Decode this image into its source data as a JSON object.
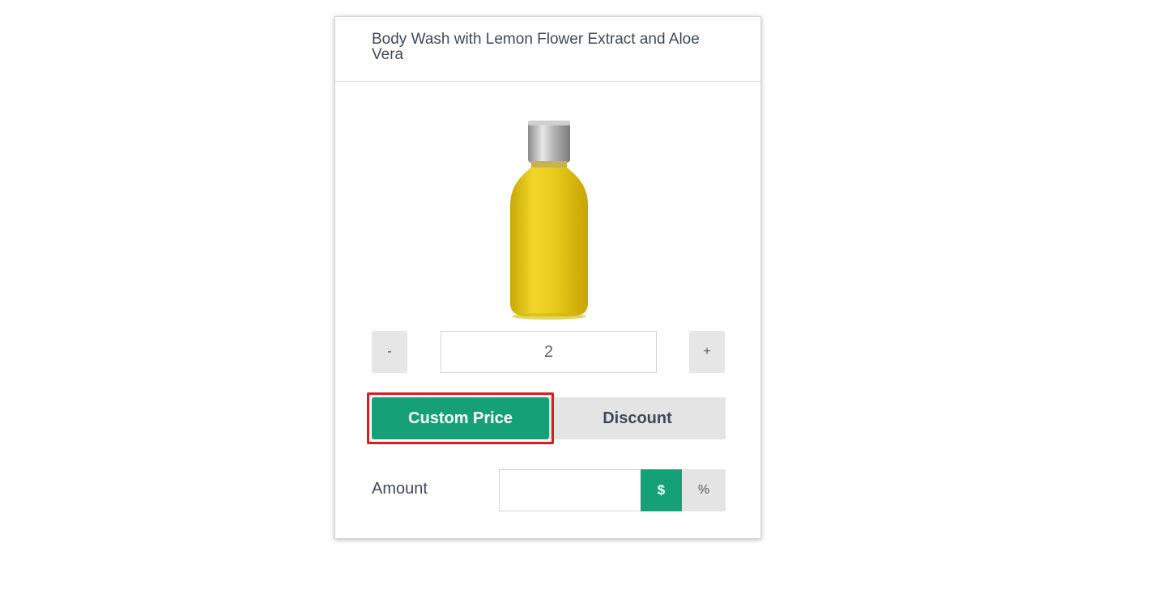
{
  "product": {
    "title": "Body Wash with Lemon Flower Extract and Aloe Vera",
    "image_icon": "yellow-bottle-image"
  },
  "quantity": {
    "minus_label": "-",
    "value": "2",
    "plus_label": "+"
  },
  "price_mode": {
    "custom_price_label": "Custom Price",
    "discount_label": "Discount",
    "selected": "Custom Price"
  },
  "amount": {
    "label": "Amount",
    "value": "",
    "currency_label": "$",
    "percent_label": "%"
  },
  "colors": {
    "accent": "#16a077",
    "highlight": "#e1191f",
    "inactive": "#e4e4e4"
  }
}
